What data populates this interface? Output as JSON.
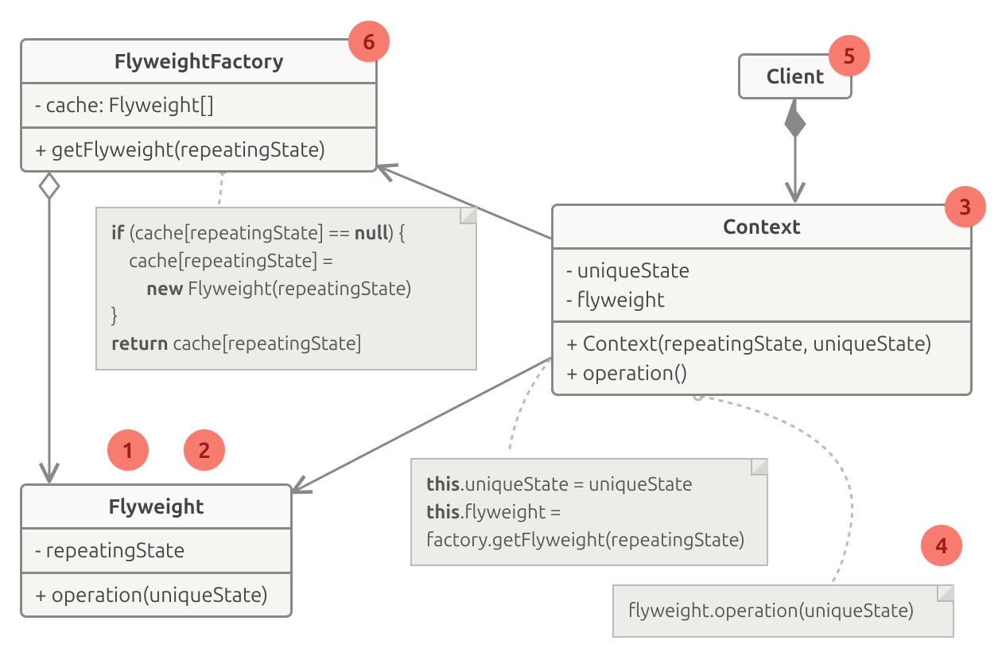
{
  "classes": {
    "flyweightFactory": {
      "name": "FlyweightFactory",
      "attrs": "- cache: Flyweight[]",
      "ops": "+ getFlyweight(repeatingState)"
    },
    "client": {
      "name": "Client"
    },
    "context": {
      "name": "Context",
      "attr1": "- uniqueState",
      "attr2": "- flyweight",
      "op1": "+ Context(repeatingState, uniqueState)",
      "op2": "+ operation()"
    },
    "flyweight": {
      "name": "Flyweight",
      "attrs": "- repeatingState",
      "ops": "+ operation(uniqueState)"
    }
  },
  "notes": {
    "factory": {
      "l1a": "if",
      "l1b": " (cache[repeatingState] == ",
      "l1c": "null",
      "l1d": ") {",
      "l2": "    cache[repeatingState] =",
      "l3a": "        ",
      "l3b": "new",
      "l3c": " Flyweight(repeatingState)",
      "l4": "}",
      "l5a": "return",
      "l5b": " cache[repeatingState]"
    },
    "contextCtor": {
      "l1a": "this",
      "l1b": ".uniqueState = uniqueState",
      "l2a": "this",
      "l2b": ".flyweight =",
      "l3": "factory.getFlyweight(repeatingState)"
    },
    "operation": {
      "text": "flyweight.operation(uniqueState)"
    }
  },
  "badges": {
    "b1": "1",
    "b2": "2",
    "b3": "3",
    "b4": "4",
    "b5": "5",
    "b6": "6"
  }
}
